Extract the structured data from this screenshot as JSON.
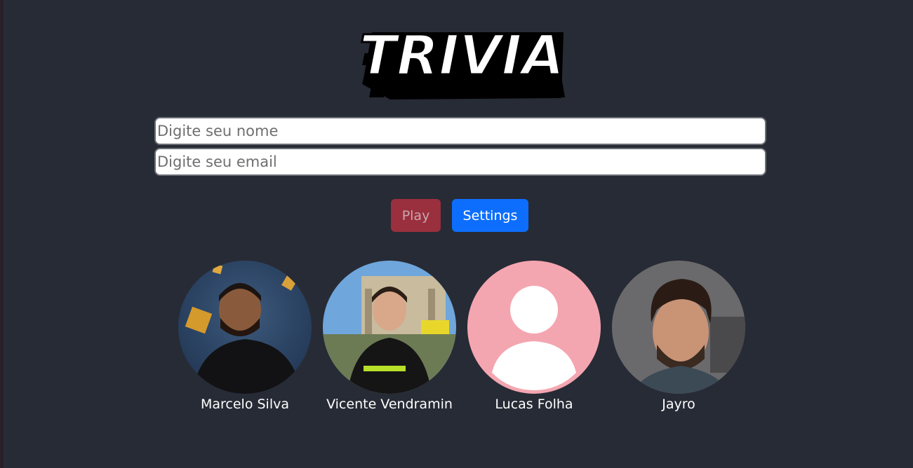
{
  "app": {
    "logo_text": "TRIVIA"
  },
  "form": {
    "name_placeholder": "Digite seu nome",
    "name_value": "",
    "email_placeholder": "Digite seu email",
    "email_value": ""
  },
  "actions": {
    "play_label": "Play",
    "settings_label": "Settings"
  },
  "team": {
    "members": [
      {
        "name": "Marcelo Silva"
      },
      {
        "name": "Vicente Vendramin"
      },
      {
        "name": "Lucas Folha"
      },
      {
        "name": "Jayro"
      }
    ]
  },
  "colors": {
    "background": "#272b35",
    "play_button": "#9a2f3e",
    "settings_button": "#0d6efd",
    "placeholder_avatar": "#f4a6b0"
  }
}
